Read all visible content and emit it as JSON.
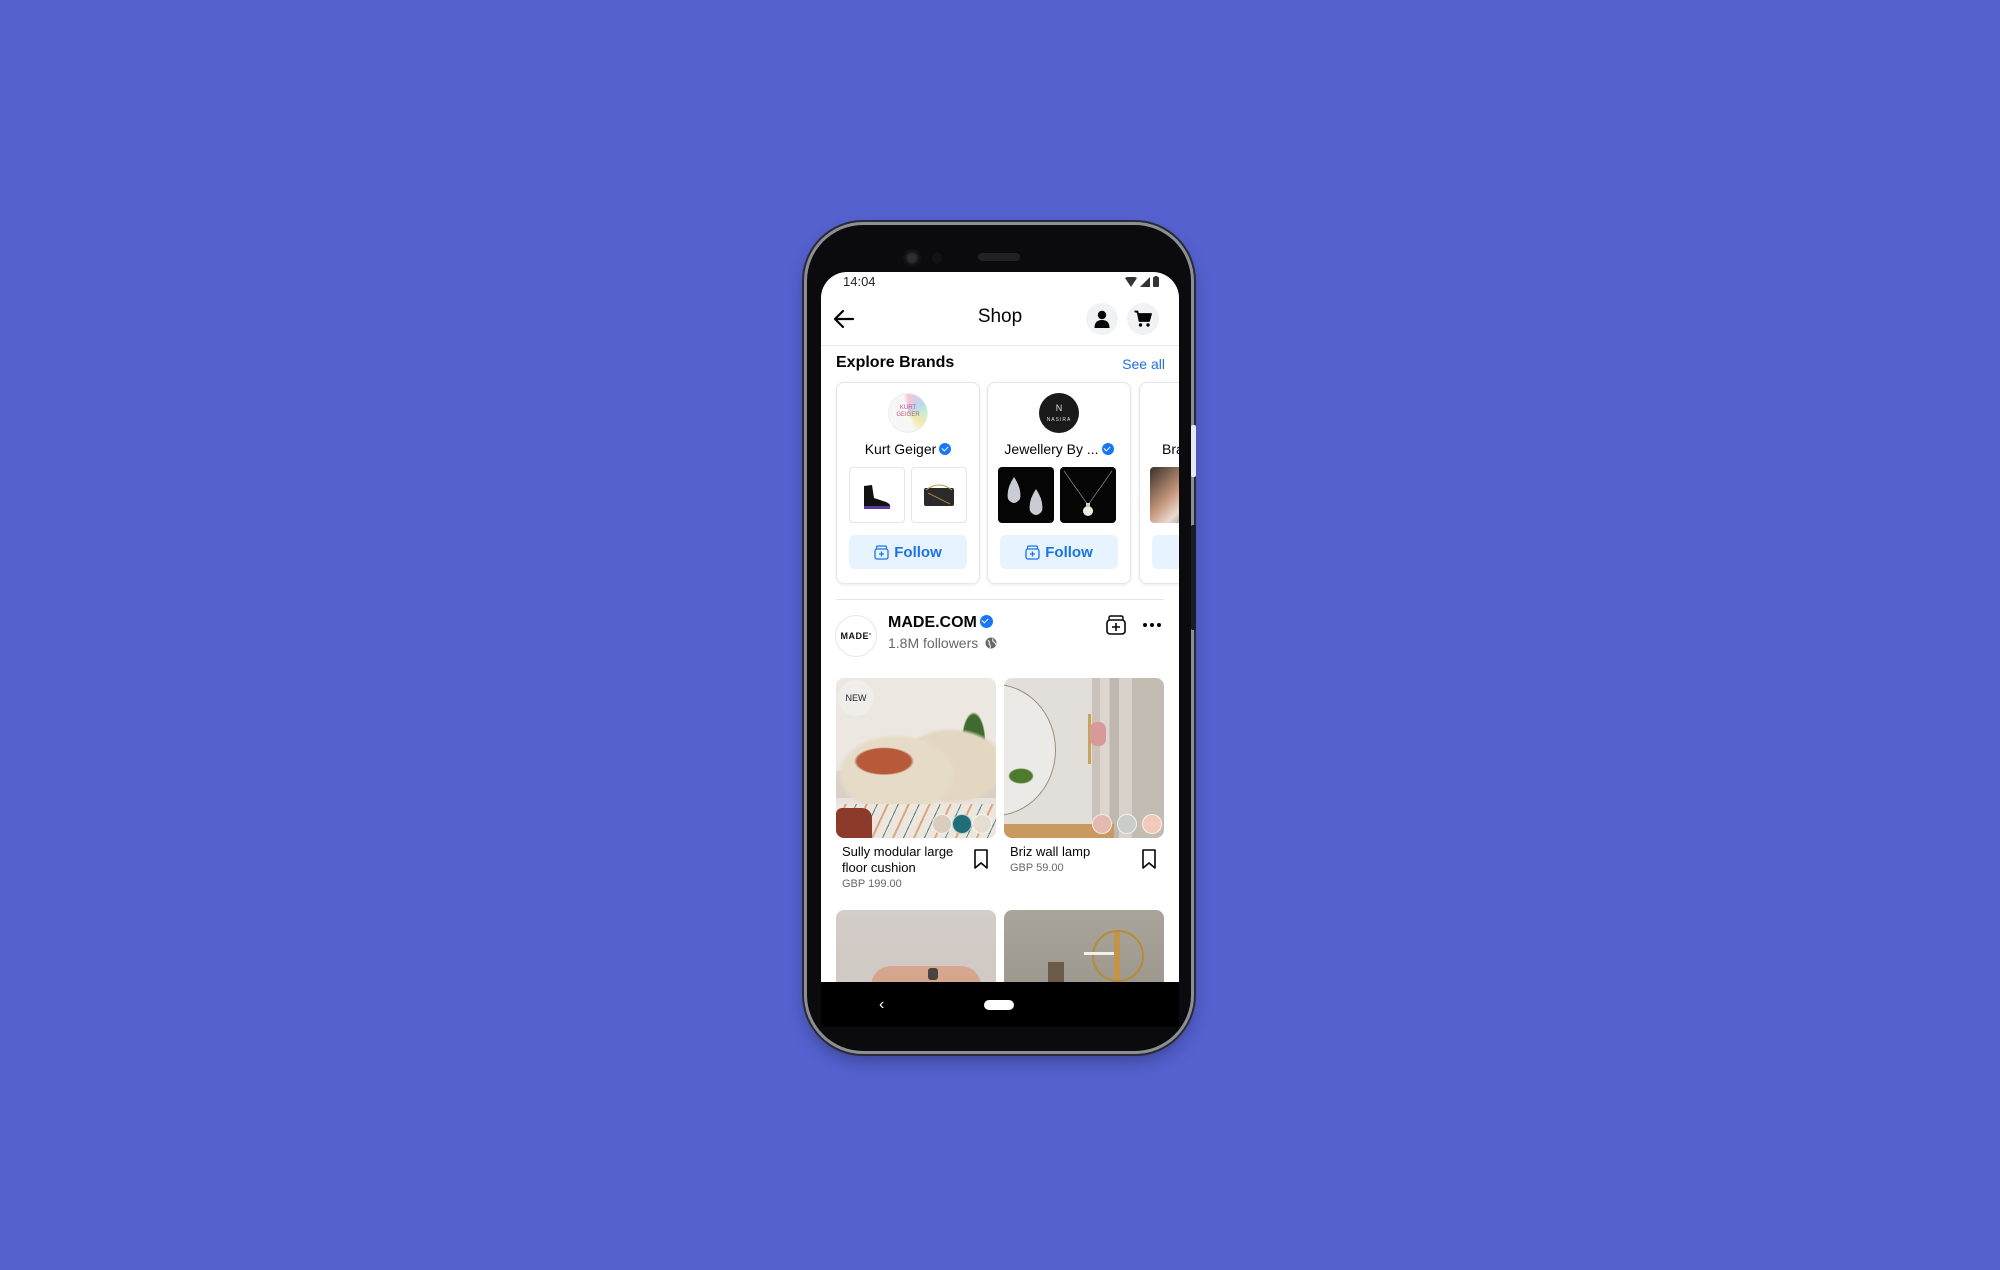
{
  "status_bar": {
    "time": "14:04",
    "icons": [
      "wifi-icon",
      "signal-icon",
      "battery-icon"
    ]
  },
  "app_bar": {
    "title": "Shop",
    "back_icon": "arrow-left-icon",
    "profile_icon": "person-icon",
    "cart_icon": "cart-icon"
  },
  "explore_brands": {
    "title": "Explore Brands",
    "see_all": "See all",
    "brands": [
      {
        "name": "Kurt Geiger",
        "logo_text": "KURT GEIGER",
        "verified": true,
        "follow_label": "Follow",
        "thumbs": [
          "black sock sneaker",
          "black quilted bag with gold chain"
        ]
      },
      {
        "name": "Jewellery By ...",
        "logo_text": "NASIRA",
        "verified": true,
        "follow_label": "Follow",
        "thumbs": [
          "diamond teardrop earrings",
          "pearl pendant necklace"
        ]
      },
      {
        "name": "Bra",
        "verified": false,
        "follow_label": "",
        "thumbs": [
          "hand with rings"
        ]
      }
    ]
  },
  "shop": {
    "logo_text": "MADE",
    "name": "MADE.COM",
    "verified": true,
    "followers": "1.8M followers",
    "privacy_icon": "globe-icon",
    "follow_icon": "shop-follow-icon",
    "more_icon": "more-horizontal-icon",
    "products": [
      {
        "name": "Sully modular large floor cushion",
        "price": "GBP 199.00",
        "badge": "NEW",
        "swatches": [
          "#d9cdbd",
          "#1f6e78",
          "#e6ddd2"
        ]
      },
      {
        "name": "Briz wall lamp",
        "price": "GBP 59.00",
        "badge": "",
        "swatches": [
          "#e5b8b0",
          "#c9ccc9",
          "#f0c9b8"
        ]
      },
      {
        "name": "",
        "price": ""
      },
      {
        "name": "",
        "price": ""
      }
    ]
  },
  "nav_bar": {
    "back_icon": "nav-back-icon",
    "home_icon": "nav-home-pill"
  },
  "colors": {
    "background": "#5461cf",
    "accent": "#1877f2",
    "follow_bg": "#e7f3ff",
    "follow_text": "#1b74e4"
  }
}
